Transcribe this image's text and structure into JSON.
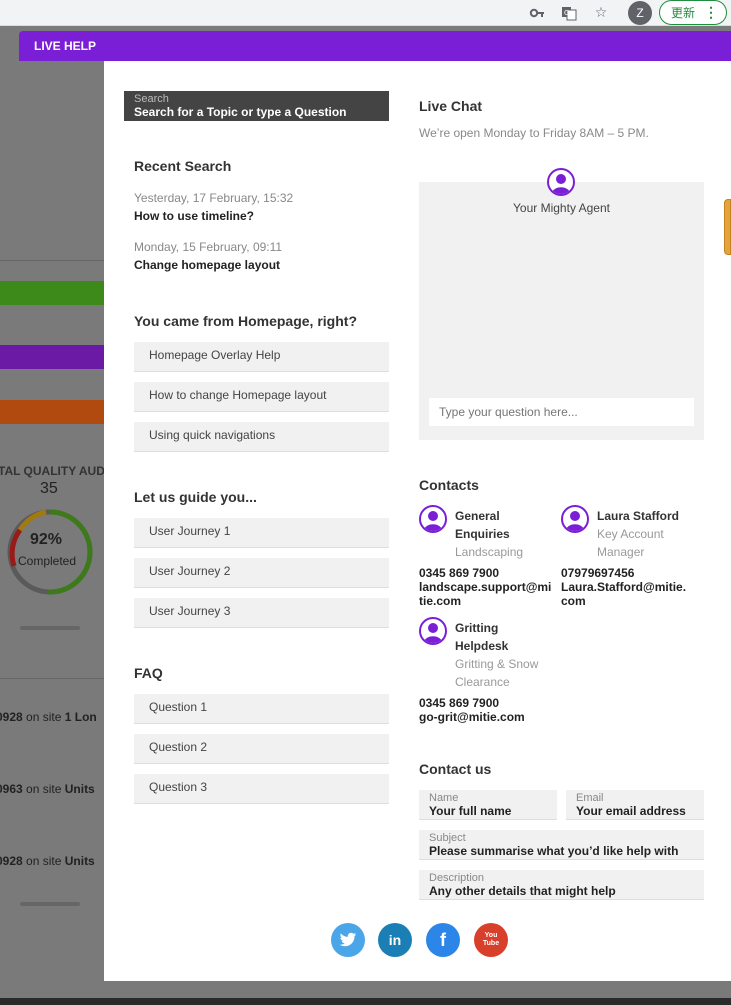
{
  "browser": {
    "avatar_letter": "Z",
    "update_label": "更新",
    "icons": [
      "key-icon",
      "translate-icon",
      "star-icon"
    ]
  },
  "background": {
    "section_title": "TAL QUALITY AUD",
    "count": "35",
    "donut_percent": "92%",
    "donut_percent_value": 0.92,
    "donut_label": "Completed",
    "rows": [
      {
        "id": "0928",
        "mid": " on site ",
        "site": "1 Lon"
      },
      {
        "id": "0963",
        "mid": " on site ",
        "site": "Units"
      },
      {
        "id": "0928",
        "mid": " on site ",
        "site": "Units"
      }
    ],
    "bar_colors": [
      "#3d8a1a",
      "#6a1aa4",
      "#b04a0f"
    ]
  },
  "header": {
    "title": "LIVE HELP",
    "color": "#7a1fd6"
  },
  "search": {
    "label": "Search",
    "placeholder": "Search for a Topic or type a Question"
  },
  "recent": {
    "title": "Recent Search",
    "items": [
      {
        "time": "Yesterday, 17 February, 15:32",
        "text": "How to use timeline?"
      },
      {
        "time": "Monday, 15 February, 09:11",
        "text": "Change homepage layout"
      }
    ]
  },
  "came_from": {
    "title": "You came from Homepage, right?",
    "items": [
      "Homepage Overlay Help",
      "How to change Homepage layout",
      "Using quick navigations"
    ]
  },
  "guide": {
    "title": "Let us guide you...",
    "items": [
      "User Journey 1",
      "User Journey 2",
      "User Journey 3"
    ]
  },
  "faq": {
    "title": "FAQ",
    "items": [
      "Question 1",
      "Question 2",
      "Question 3"
    ]
  },
  "live_chat": {
    "title": "Live Chat",
    "hours": "We’re open Monday to Friday 8AM – 5 PM.",
    "agent": "Your Mighty Agent",
    "input_placeholder": "Type your question here..."
  },
  "contacts": {
    "title": "Contacts",
    "people": [
      {
        "name_l1": "General",
        "name_l2": "Enquiries",
        "role_l1": "Landscaping",
        "role_l2": "",
        "phone": "0345 869 7900",
        "email_l1": "landscape.support@mi",
        "email_l2": "tie.com"
      },
      {
        "name_l1": "Laura Stafford",
        "name_l2": "",
        "role_l1": "Key Account",
        "role_l2": "Manager",
        "phone": "07979697456",
        "email_l1": "Laura.Stafford@mitie.",
        "email_l2": "com"
      },
      {
        "name_l1": "Gritting",
        "name_l2": "Helpdesk",
        "role_l1": "Gritting & Snow",
        "role_l2": "Clearance",
        "phone": "0345 869 7900",
        "email_l1": "go-grit@mitie.com",
        "email_l2": ""
      }
    ]
  },
  "contact_us": {
    "title": "Contact us",
    "name": {
      "label": "Name",
      "placeholder": "Your full name"
    },
    "email": {
      "label": "Email",
      "placeholder": "Your email address"
    },
    "subject": {
      "label": "Subject",
      "placeholder": "Please summarise what you’d like help with"
    },
    "description": {
      "label": "Description",
      "placeholder": "Any other details that might help"
    }
  },
  "social": [
    {
      "name": "twitter",
      "color": "#4aa6e8"
    },
    {
      "name": "linkedin",
      "color": "#1b7fb5"
    },
    {
      "name": "facebook",
      "color": "#2b86e8"
    },
    {
      "name": "youtube",
      "color": "#d8402c",
      "glyph": "You Tube"
    }
  ]
}
